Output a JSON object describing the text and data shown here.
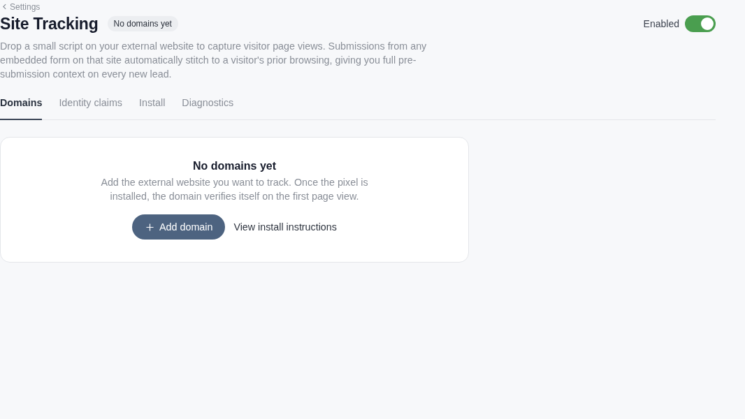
{
  "back_link": {
    "label": "Settings"
  },
  "header": {
    "title": "Site Tracking",
    "badge": "No domains yet",
    "toggle": {
      "label": "Enabled",
      "on": true
    }
  },
  "description": "Drop a small script on your external website to capture visitor page views. Submissions from any embedded form on that site automatically stitch to a visitor's prior browsing, giving you full pre-submission context on every new lead.",
  "tabs": [
    {
      "label": "Domains",
      "selected": true
    },
    {
      "label": "Identity claims",
      "selected": false
    },
    {
      "label": "Install",
      "selected": false
    },
    {
      "label": "Diagnostics",
      "selected": false
    }
  ],
  "empty_state": {
    "title": "No domains yet",
    "text": "Add the external website you want to track. Once the pixel is installed, the domain verifies itself on the first page view.",
    "primary_button": "Add domain",
    "secondary_link": "View install instructions"
  }
}
